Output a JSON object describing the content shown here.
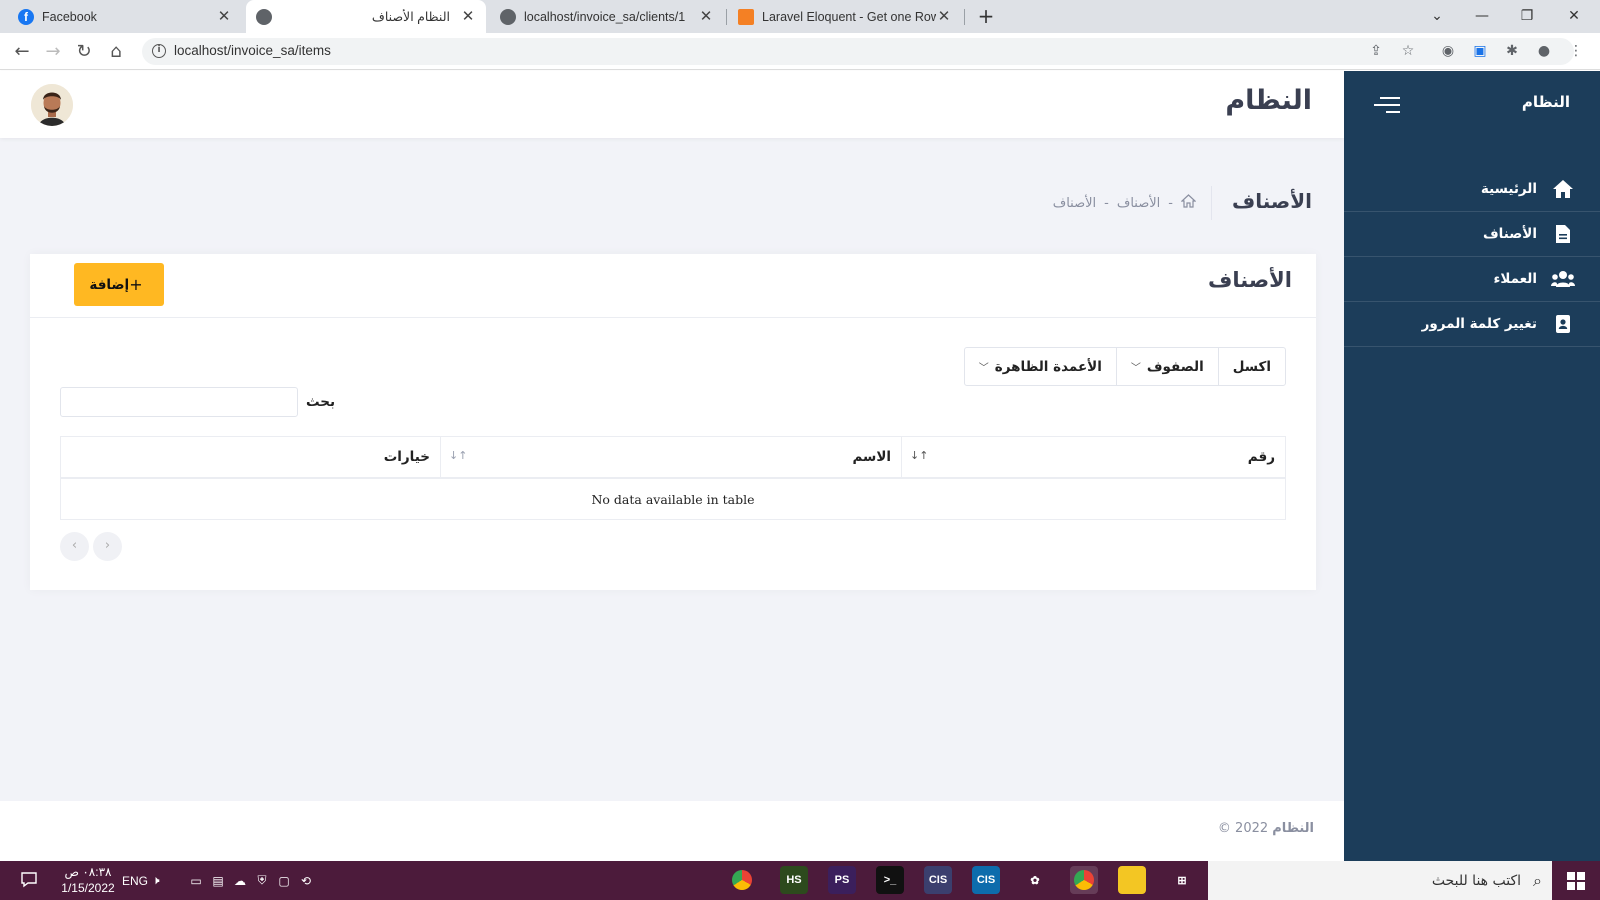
{
  "browser": {
    "tabs": [
      {
        "title": "Facebook",
        "active": false
      },
      {
        "title": "النظام الأصناف",
        "active": true
      },
      {
        "title": "localhost/invoice_sa/clients/1",
        "active": false
      },
      {
        "title": "Laravel Eloquent - Get one Row -",
        "active": false
      }
    ],
    "url": "localhost/invoice_sa/items"
  },
  "sidebar": {
    "brand": "النظام",
    "items": [
      {
        "label": "الرئيسية",
        "icon": "home-icon"
      },
      {
        "label": "الأصناف",
        "icon": "document-icon"
      },
      {
        "label": "العملاء",
        "icon": "users-icon"
      },
      {
        "label": "تغيير كلمة المرور",
        "icon": "address-book-icon"
      }
    ]
  },
  "header": {
    "title": "النظام"
  },
  "subheader": {
    "title": "الأصناف",
    "breadcrumb": [
      "الأصناف",
      "الأصناف"
    ]
  },
  "card": {
    "title": "الأصناف",
    "add_label": "إضافة",
    "buttons": {
      "excel": "اكسل",
      "rows": "الصفوف",
      "columns": "الأعمدة الظاهرة"
    },
    "search_label": "بحث",
    "table": {
      "headers": [
        "رقم",
        "الاسم",
        "خيارات"
      ],
      "empty": "No data available in table"
    }
  },
  "footer": {
    "brand": "النظام",
    "year": "2022 ©"
  },
  "taskbar": {
    "search_placeholder": "اكتب هنا للبحث",
    "time": "٠٨:٣٨ ص",
    "date": "1/15/2022",
    "lang": "ENG"
  },
  "colors": {
    "sidebar": "#1c3d5a",
    "accent": "#ffb822",
    "taskbar": "#4c1b3b"
  }
}
